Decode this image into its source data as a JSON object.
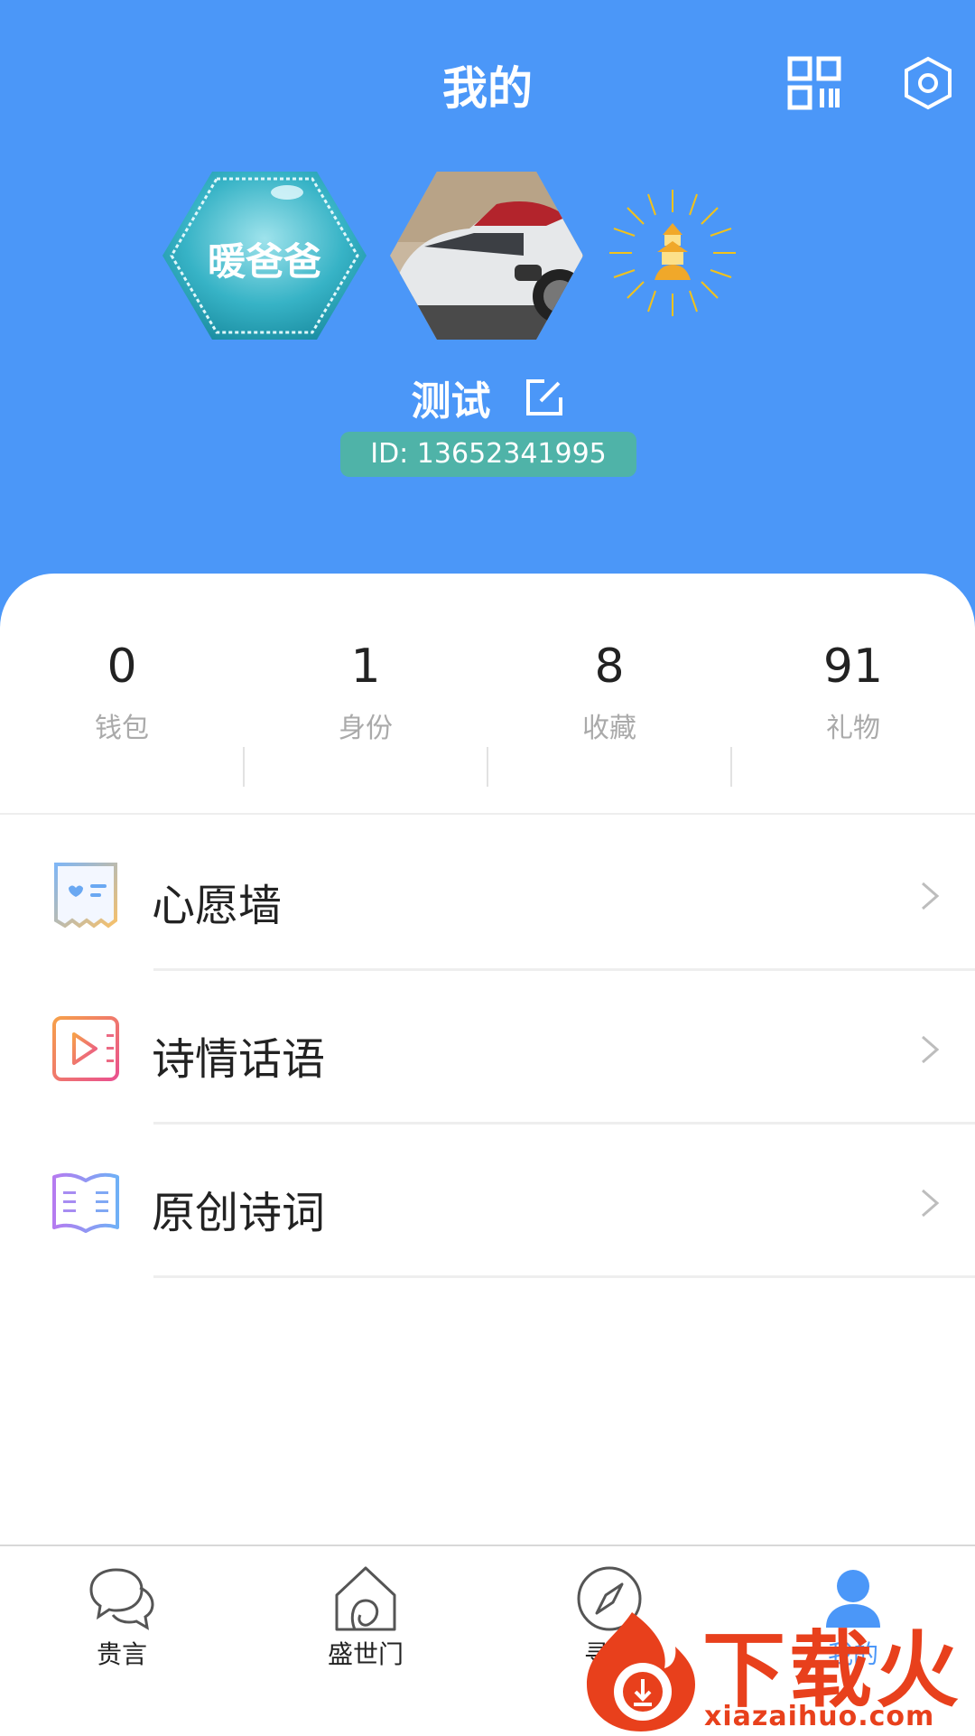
{
  "header": {
    "title": "我的",
    "qr_icon": "qr-code-icon",
    "settings_icon": "hexagon-settings-icon"
  },
  "badges": [
    {
      "label": "暖爸爸",
      "icon": "teal-hexagon-badge"
    },
    {
      "label": "",
      "icon": "car-photo-hexagon"
    },
    {
      "label": "",
      "icon": "sun-pagoda-emblem"
    }
  ],
  "profile": {
    "name": "测试",
    "edit_icon": "edit-icon",
    "id_text": "ID: 13652341995"
  },
  "stats": [
    {
      "value": "0",
      "label": "钱包"
    },
    {
      "value": "1",
      "label": "身份"
    },
    {
      "value": "8",
      "label": "收藏"
    },
    {
      "value": "91",
      "label": "礼物"
    }
  ],
  "menu": [
    {
      "label": "心愿墙",
      "icon": "wish-card-icon"
    },
    {
      "label": "诗情话语",
      "icon": "video-play-icon"
    },
    {
      "label": "原创诗词",
      "icon": "open-book-icon"
    }
  ],
  "tabs": [
    {
      "label": "贵言",
      "icon": "chat-bubbles-icon"
    },
    {
      "label": "盛世门",
      "icon": "house-icon"
    },
    {
      "label": "寻觅",
      "icon": "compass-icon"
    },
    {
      "label": "我的",
      "icon": "user-icon"
    }
  ],
  "watermark": {
    "text_big": "下载火",
    "text_small": "xiazaihuo.com"
  },
  "colors": {
    "header_bg": "#4b97f8",
    "id_badge": "#4fb3a8",
    "active_tab": "#4b97f8",
    "watermark": "#e8401c"
  }
}
